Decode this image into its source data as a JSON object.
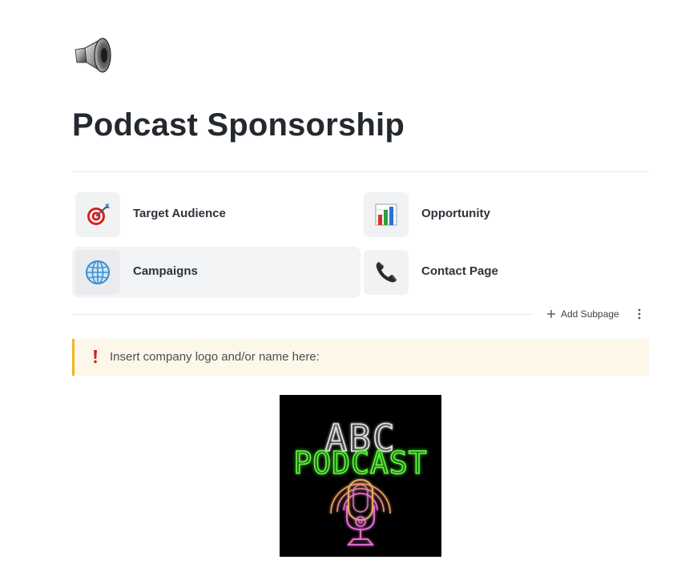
{
  "page": {
    "icon": "speaker-icon",
    "title": "Podcast Sponsorship"
  },
  "subpages": [
    {
      "label": "Target Audience",
      "icon": "target-dart-icon"
    },
    {
      "label": "Opportunity",
      "icon": "bar-chart-icon"
    },
    {
      "label": "Campaigns",
      "icon": "globe-icon"
    },
    {
      "label": "Contact Page",
      "icon": "telephone-icon"
    }
  ],
  "actions": {
    "add_subpage_label": "Add Subpage",
    "more_icon": "vertical-dots-icon"
  },
  "callout": {
    "icon": "exclamation-icon",
    "text": "Insert company logo and/or name here:"
  },
  "logo": {
    "line1": "ABC",
    "line2": "PODCAST",
    "icon": "microphone-icon"
  },
  "colors": {
    "callout_bg": "#fdf7ea",
    "callout_border": "#f2b51c",
    "exclamation": "#d0231b",
    "logo_green": "#5dff3a",
    "logo_pink": "#ee6fd6",
    "logo_orange": "#f2a25a"
  }
}
